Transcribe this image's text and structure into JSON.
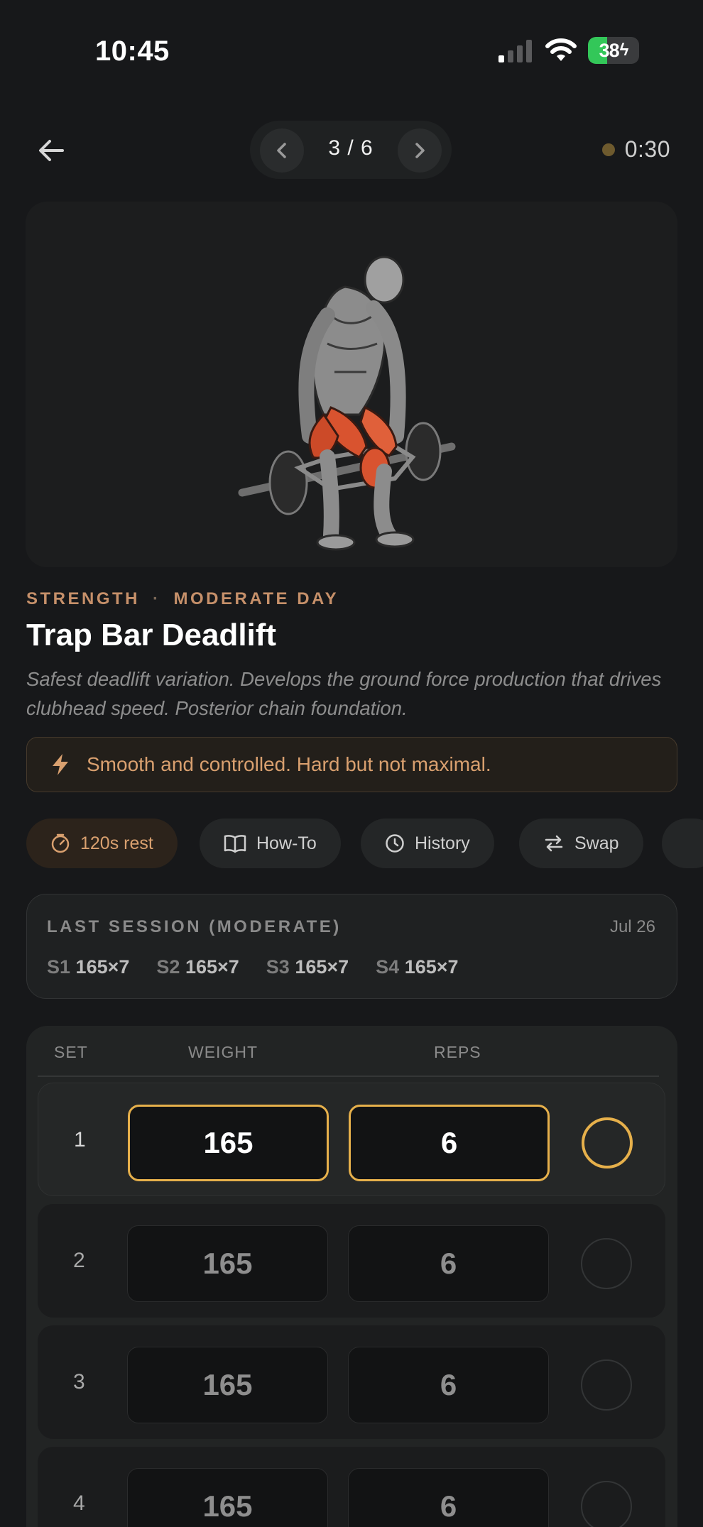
{
  "status_bar": {
    "time": "10:45",
    "battery": "38",
    "battery_level": 0.38
  },
  "nav": {
    "pager": "3 / 6",
    "timer": "0:30"
  },
  "exercise": {
    "category": "STRENGTH",
    "separator": "·",
    "day": "MODERATE DAY",
    "title": "Trap Bar Deadlift",
    "description": "Safest deadlift variation. Develops the ground force production that drives clubhead speed. Posterior chain foundation.",
    "cue": "Smooth and controlled. Hard but not maximal."
  },
  "chips": [
    {
      "label": "120s rest",
      "icon": "timer-icon"
    },
    {
      "label": "How-To",
      "icon": "book-icon"
    },
    {
      "label": "History",
      "icon": "clock-icon"
    },
    {
      "label": "Swap",
      "icon": "swap-icon"
    }
  ],
  "last_session": {
    "label": "LAST SESSION (MODERATE)",
    "date": "Jul 26",
    "sets": [
      {
        "set": "S1",
        "value": "165×7"
      },
      {
        "set": "S2",
        "value": "165×7"
      },
      {
        "set": "S3",
        "value": "165×7"
      },
      {
        "set": "S4",
        "value": "165×7"
      }
    ]
  },
  "sets_table": {
    "headers": {
      "set": "SET",
      "weight": "WEIGHT",
      "reps": "REPS"
    },
    "rows": [
      {
        "num": "1",
        "weight": "165",
        "reps": "6",
        "active": true
      },
      {
        "num": "2",
        "weight": "165",
        "reps": "6",
        "active": false
      },
      {
        "num": "3",
        "weight": "165",
        "reps": "6",
        "active": false
      },
      {
        "num": "4",
        "weight": "165",
        "reps": "6",
        "active": false
      }
    ]
  },
  "colors": {
    "accent": "#e6b04b",
    "cue": "#d9a06f",
    "background": "#17181a",
    "battery": "#33c759"
  }
}
